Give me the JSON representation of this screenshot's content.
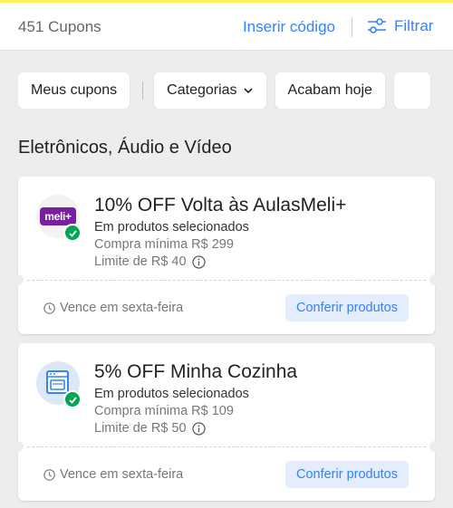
{
  "header": {
    "coupon_count": "451 Cupons",
    "insert_code": "Inserir código",
    "filter_label": "Filtrar"
  },
  "chips": [
    {
      "label": "Meus cupons"
    },
    {
      "label": "Categorias"
    },
    {
      "label": "Acabam hoje"
    }
  ],
  "section": {
    "title": "Eletrônicos, Áudio e Vídeo"
  },
  "coupons": [
    {
      "icon": "meli-plus-logo",
      "logo_text": "meli+",
      "title": "10% OFF Volta às AulasMeli+",
      "scope": "Em produtos selecionados",
      "min_purchase": "Compra mínima R$ 299",
      "limit": "Limite de R$ 40",
      "expiry": "Vence em sexta-feira",
      "action": "Conferir produtos"
    },
    {
      "icon": "kitchen-oven-icon",
      "title": "5% OFF Minha Cozinha",
      "scope": "Em produtos selecionados",
      "min_purchase": "Compra mínima R$ 109",
      "limit": "Limite de R$ 50",
      "expiry": "Vence em sexta-feira",
      "action": "Conferir produtos"
    }
  ],
  "colors": {
    "accent": "#3483fa",
    "success": "#00a650",
    "meli_purple": "#7a1fa2",
    "brand_yellow": "#fff159"
  }
}
